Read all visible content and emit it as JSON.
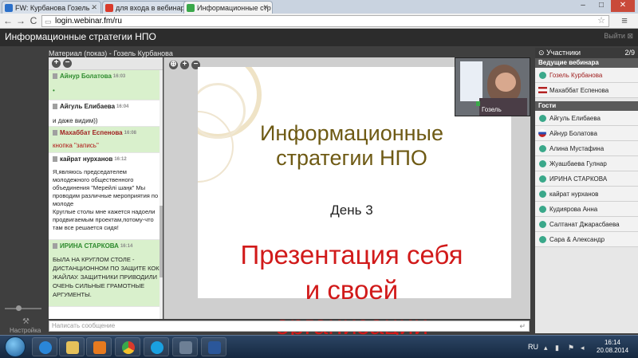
{
  "browser": {
    "tabs": [
      {
        "label": "FW: Курбанова Гозель -",
        "active": false
      },
      {
        "label": "для входа в вебинарную",
        "active": false
      },
      {
        "label": "Информационные стр",
        "active": true
      }
    ],
    "url": "login.webinar.fm/ru",
    "window_controls": {
      "minimize": "–",
      "maximize": "□",
      "close": "✕"
    },
    "nav": {
      "back": "←",
      "forward": "→",
      "reload": "C",
      "menu": "≡"
    }
  },
  "app": {
    "title": "Информационные стратегии НПО",
    "exit_label": "Выйти ⊠"
  },
  "material": {
    "title": "Материал (показ) - Гозель Курбанова"
  },
  "chat": {
    "messages": [
      {
        "author": "Айнур Болатова",
        "time": "16:03",
        "author_color": "green",
        "text": "•",
        "text_class": "",
        "green": true
      },
      {
        "author": "Айгуль Елибаева",
        "time": "16:04",
        "author_color": "",
        "text": "и даже видим))",
        "text_class": "",
        "green": false
      },
      {
        "author": "Махаббат Еспенова",
        "time": "16:08",
        "author_color": "red",
        "text": "кнопка \"запись\"",
        "text_class": "red",
        "green": true
      },
      {
        "author": "кайрат нурханов",
        "time": "16:12",
        "author_color": "",
        "text": "Я,являюсь председателем молодежного общественного объединения \"Мерейлi шаңк\" Мы проводим различные мероприятия по молоде\nКруглые столы мне кажется надоели продвигаемым проектам,потому-что там все решается сидя!",
        "text_class": "",
        "green": false
      },
      {
        "author": "ИРИНА СТАРКОВА",
        "time": "16:14",
        "author_color": "green",
        "text": "БЫЛА НА КРУГЛОМ СТОЛЕ - ДИСТАНЦИОННОМ ПО ЗАЩИТЕ КОК ЖАЙЛАУ. ЗАЩИТНИКИ ПРИВОДИЛИ ОЧЕНЬ СИЛЬНЫЕ ГРАМОТНЫЕ АРГУМЕНТЫ.",
        "text_class": "",
        "green": true
      }
    ],
    "input_placeholder": "Написать сообщение",
    "send_icon": "↵"
  },
  "slide": {
    "title_line1": "Информационные",
    "title_line2": "стратегии НПО",
    "day": "День 3",
    "subtitle_line1": "Презентация себя",
    "subtitle_line2": "и своей",
    "subtitle_line3": "организации"
  },
  "webcam": {
    "label": "Гозель"
  },
  "participants": {
    "header": "Участники",
    "count": "2/9",
    "hosts_label": "Ведущие вебинара",
    "hosts": [
      {
        "name": "Гозель Курбанова",
        "color": "red",
        "icon": "dot"
      },
      {
        "name": "Махаббат Еспенова",
        "color": "",
        "icon": "flag-kz"
      }
    ],
    "guests_label": "Гости",
    "guests": [
      {
        "name": "Айгуль Елибаева",
        "icon": "dot"
      },
      {
        "name": "Айнур Болатова",
        "icon": "flag-ru"
      },
      {
        "name": "Алина Мустафина",
        "icon": "dot"
      },
      {
        "name": "Жуашбаева Гулнар",
        "icon": "dot"
      },
      {
        "name": "ИРИНА СТАРКОВА",
        "icon": "dot"
      },
      {
        "name": "кайрат нурханов",
        "icon": "dot"
      },
      {
        "name": "Кудиярова Анна",
        "icon": "dot"
      },
      {
        "name": "Салтанат Джарасбаева",
        "icon": "dot"
      },
      {
        "name": "Сара & Александр",
        "icon": "dot"
      }
    ]
  },
  "settings": {
    "label": "Настройка"
  },
  "taskbar": {
    "lang": "RU",
    "time": "16:14",
    "date": "20.08.2014"
  },
  "colors": {
    "host_accent": "#a02020",
    "guest_dot": "#3aa88a",
    "slide_title": "#6e5a14",
    "slide_subtitle": "#d11a1a"
  }
}
